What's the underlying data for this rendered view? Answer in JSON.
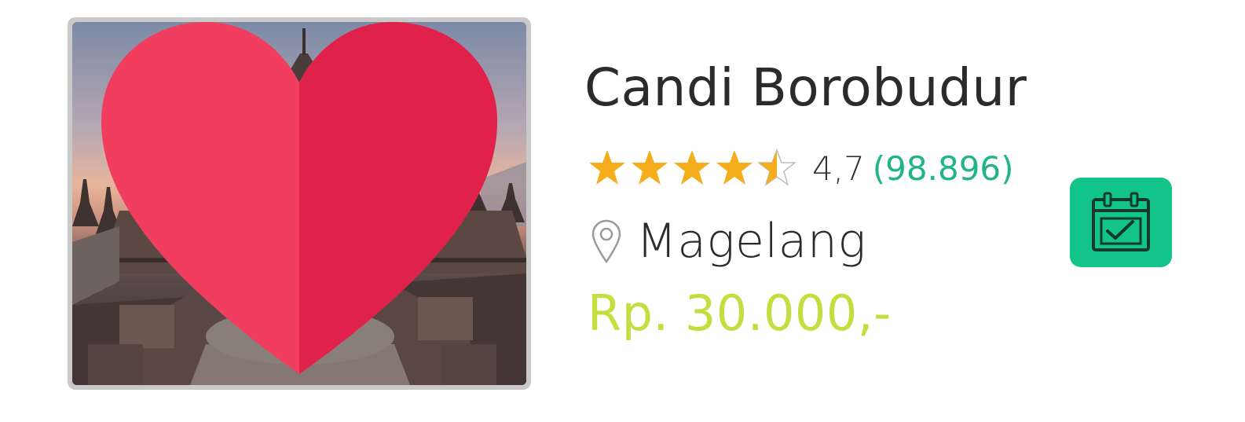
{
  "place": {
    "name": "Candi Borobudur",
    "rating_value": "4,7",
    "rating_count": "(98.896)",
    "rating_stars": 4.5,
    "location": "Magelang",
    "price": "Rp. 30.000,-"
  },
  "colors": {
    "star": "#f6ad1b",
    "rating_count": "#21b38a",
    "price": "#c6dd3f",
    "book_button": "#12c48a",
    "favorite": "#f23e5e"
  },
  "icons": {
    "favorite": "heart-icon",
    "location": "map-pin-icon",
    "book": "calendar-check-icon"
  }
}
